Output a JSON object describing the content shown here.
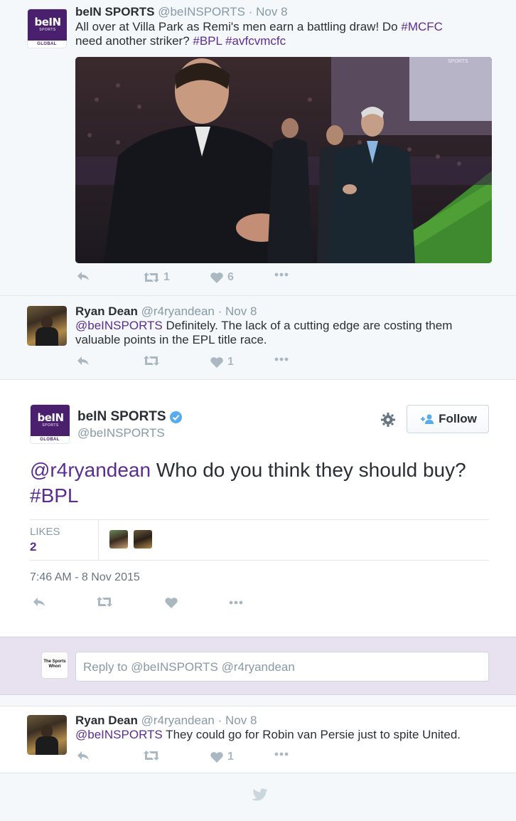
{
  "tweet1": {
    "name": "beIN SPORTS",
    "handle": "@beINSPORTS",
    "time": "Nov 8",
    "text_plain": "All over at Villa Park as Remi's men earn a battling draw! Do ",
    "tag_mcfc": "#MCFC",
    "text_mid": "need another striker? ",
    "tag_bpl": "#BPL",
    "tag_avfc": "#avfcvmcfc",
    "retweets": "1",
    "likes": "6"
  },
  "logo": {
    "word": "beIN",
    "sports": "SPORTS",
    "global": "GLOBAL"
  },
  "tweet2": {
    "name": "Ryan Dean",
    "handle": "@r4ryandean",
    "time": "Nov 8",
    "mention": "@beINSPORTS",
    "text": " Definitely. The lack of a cutting edge are costing them valuable points in the EPL title race.",
    "likes": "1"
  },
  "focus": {
    "name": "beIN SPORTS",
    "handle": "@beINSPORTS",
    "follow_label": "Follow",
    "mention": "@r4ryandean",
    "text": " Who do you think they should buy? ",
    "tag": "#BPL",
    "likes_label": "LIKES",
    "likes_count": "2",
    "timestamp": "7:46 AM - 8 Nov 2015"
  },
  "reply": {
    "placeholder": "Reply to @beINSPORTS @r4ryandean",
    "logo_text": "The Sports Whori"
  },
  "tweet3": {
    "name": "Ryan Dean",
    "handle": "@r4ryandean",
    "time": "Nov 8",
    "mention": "@beINSPORTS",
    "text": " They could go for Robin van Persie just to spite United.",
    "likes": "1"
  },
  "colors": {
    "link": "#5c2d91",
    "muted": "#8899a6",
    "brand": "#4a1f6e",
    "verified": "#55acee"
  }
}
